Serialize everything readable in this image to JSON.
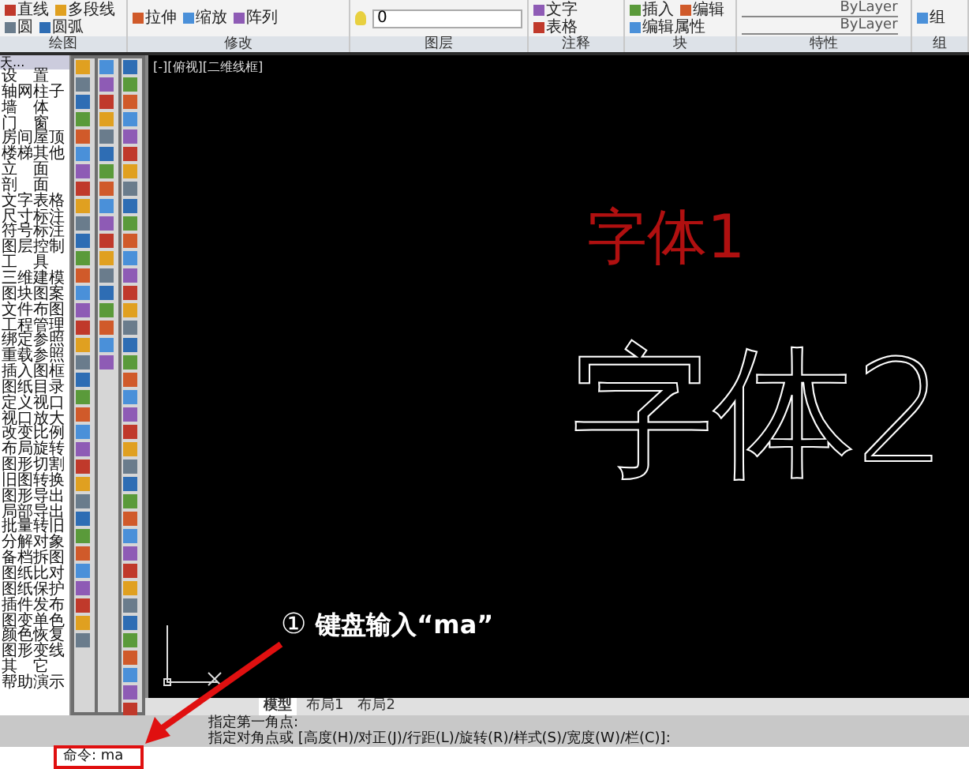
{
  "ribbon": {
    "panels": [
      {
        "kind": "tools",
        "label": "绘图",
        "tools": [
          "直线",
          "多段线",
          "圆",
          "圆弧"
        ]
      },
      {
        "kind": "tools",
        "label": "修改",
        "tools": [
          "拉伸",
          "缩放",
          "阵列"
        ]
      },
      {
        "kind": "layer",
        "label": "图层",
        "value": "0"
      },
      {
        "kind": "tools",
        "label": "注释",
        "tools": [
          "文字",
          "表格"
        ]
      },
      {
        "kind": "tools",
        "label": "块",
        "tools": [
          "插入",
          "编辑",
          "编辑属性"
        ]
      },
      {
        "kind": "lines",
        "label": "特性",
        "values": [
          "ByLayer",
          "ByLayer"
        ]
      },
      {
        "kind": "tools",
        "label": "组",
        "tools": [
          "组"
        ]
      }
    ]
  },
  "palette": {
    "header": "天...",
    "items": [
      "设　置",
      "轴网柱子",
      "墙　体",
      "门　窗",
      "房间屋顶",
      "楼梯其他",
      "立　面",
      "剖　面",
      "文字表格",
      "尺寸标注",
      "符号标注",
      "图层控制",
      "工　具",
      "三维建模",
      "图块图案",
      "文件布图",
      "工程管理",
      "绑定参照",
      "重载参照",
      "插入图框",
      "图纸目录",
      "定义视口",
      "视口放大",
      "改变比例",
      "布局旋转",
      "图形切割",
      "旧图转换",
      "图形导出",
      "局部导出",
      "批量转旧",
      "分解对象",
      "备档拆图",
      "图纸比对",
      "图纸保护",
      "插件发布",
      "图变单色",
      "颜色恢复",
      "图形变线",
      "其　它",
      "帮助演示"
    ]
  },
  "viewport": {
    "label": "[-][俯视][二维线框]",
    "texts": [
      {
        "kind": "filled",
        "text": "字体1"
      },
      {
        "kind": "outline",
        "text": "字体2"
      }
    ]
  },
  "layout_tabs": [
    {
      "label": "模型",
      "selected": true
    },
    {
      "label": "布局1",
      "selected": false
    },
    {
      "label": "布局2",
      "selected": false
    }
  ],
  "command_line": {
    "history": [
      "指定第一角点:",
      "指定对角点或 [高度(H)/对正(J)/行距(L)/旋转(R)/样式(S)/宽度(W)/栏(C)]:"
    ],
    "prompt": "命令:",
    "value": "ma"
  },
  "annotation": {
    "number": "①",
    "text": "键盘输入“ma”"
  }
}
